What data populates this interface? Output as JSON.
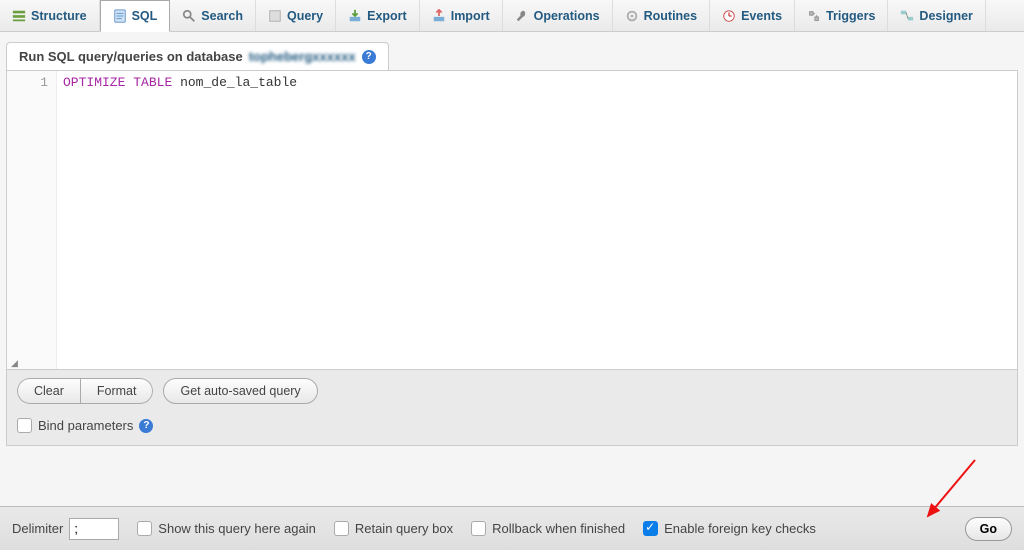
{
  "tabs": [
    {
      "label": "Structure",
      "icon": "structure"
    },
    {
      "label": "SQL",
      "icon": "sql",
      "active": true
    },
    {
      "label": "Search",
      "icon": "search"
    },
    {
      "label": "Query",
      "icon": "query"
    },
    {
      "label": "Export",
      "icon": "export"
    },
    {
      "label": "Import",
      "icon": "import"
    },
    {
      "label": "Operations",
      "icon": "wrench"
    },
    {
      "label": "Routines",
      "icon": "routines"
    },
    {
      "label": "Events",
      "icon": "events"
    },
    {
      "label": "Triggers",
      "icon": "triggers"
    },
    {
      "label": "Designer",
      "icon": "designer"
    }
  ],
  "panel": {
    "title_prefix": "Run SQL query/queries on database ",
    "database_name": "tophebergxxxxxx"
  },
  "editor": {
    "line_number": "1",
    "keyword1": "OPTIMIZE",
    "keyword2": "TABLE",
    "identifier": "nom_de_la_table"
  },
  "buttons": {
    "clear": "Clear",
    "format": "Format",
    "auto_saved": "Get auto-saved query"
  },
  "bind_params": {
    "label": "Bind parameters"
  },
  "footer": {
    "delimiter_label": "Delimiter",
    "delimiter_value": ";",
    "show_again": "Show this query here again",
    "retain": "Retain query box",
    "rollback": "Rollback when finished",
    "fkc": "Enable foreign key checks",
    "go": "Go"
  }
}
